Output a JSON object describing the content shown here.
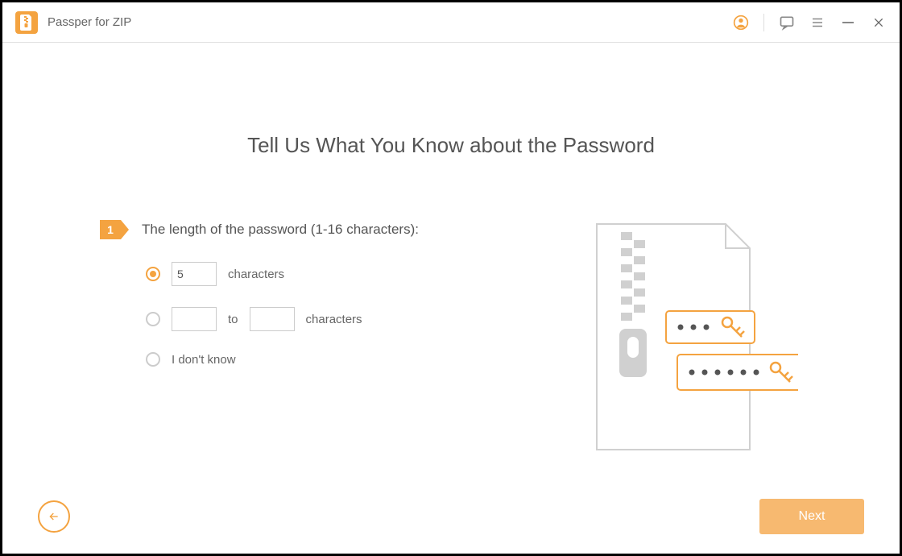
{
  "app": {
    "title": "Passper for ZIP"
  },
  "page": {
    "heading": "Tell Us What You Know about the Password",
    "step": {
      "number": "1",
      "label": "The length of the password (1-16 characters):"
    },
    "options": {
      "exact": {
        "value": "5",
        "suffix": "characters"
      },
      "range": {
        "from": "",
        "to": "",
        "joiner": "to",
        "suffix": "characters"
      },
      "unknown": {
        "label": "I don't know"
      }
    },
    "next": "Next"
  }
}
